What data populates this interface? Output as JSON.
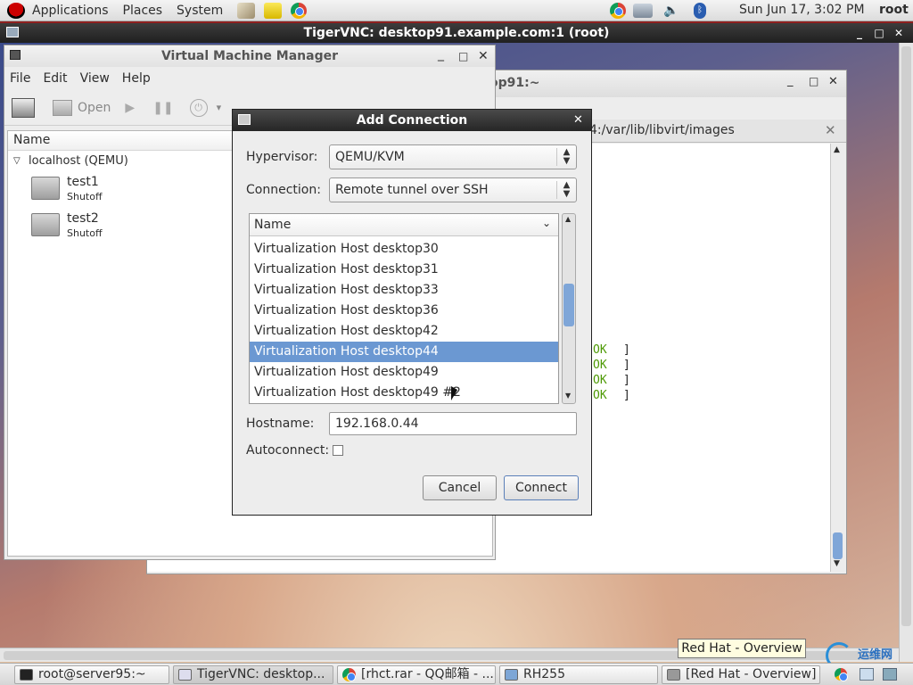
{
  "top_panel": {
    "menus": [
      "Applications",
      "Places",
      "System"
    ],
    "clock": "Sun Jun 17,  3:02 PM",
    "user": "root"
  },
  "vnc": {
    "title": "TigerVNC: desktop91.example.com:1 (root)"
  },
  "terminal": {
    "title_fragment": "op91:~",
    "tab_path": "4:/var/lib/libvirt/images",
    "ok_lines": [
      "OK",
      "OK",
      "OK",
      "OK"
    ],
    "bracket": "]"
  },
  "vmm": {
    "title": "Virtual Machine Manager",
    "menus": [
      "File",
      "Edit",
      "View",
      "Help"
    ],
    "toolbar": {
      "open_label": "Open"
    },
    "column_header": "Name",
    "connection": "localhost (QEMU)",
    "vms": [
      {
        "name": "test1",
        "state": "Shutoff"
      },
      {
        "name": "test2",
        "state": "Shutoff"
      }
    ]
  },
  "dialog": {
    "title": "Add Connection",
    "hypervisor_label": "Hypervisor:",
    "hypervisor_value": "QEMU/KVM",
    "connection_label": "Connection:",
    "connection_value": "Remote tunnel over SSH",
    "list_header": "Name",
    "hosts": [
      "Virtualization Host desktop30",
      "Virtualization Host desktop31",
      "Virtualization Host desktop33",
      "Virtualization Host desktop36",
      "Virtualization Host desktop42",
      "Virtualization Host desktop44",
      "Virtualization Host desktop49",
      "Virtualization Host desktop49 #2"
    ],
    "selected_index": 5,
    "hostname_label": "Hostname:",
    "hostname_value": "192.168.0.44",
    "autoconnect_label": "Autoconnect:",
    "cancel_label": "Cancel",
    "connect_label": "Connect"
  },
  "taskbar": {
    "items": [
      "root@server95:~",
      "TigerVNC: desktop...",
      "[rhct.rar - QQ邮箱 - ...",
      "RH255",
      "[Red Hat - Overview]"
    ],
    "tooltip": "Red Hat - Overview",
    "watermark": "运维网"
  },
  "colors": {
    "selection": "#6b98d2",
    "ok_green": "#4e9a06"
  }
}
